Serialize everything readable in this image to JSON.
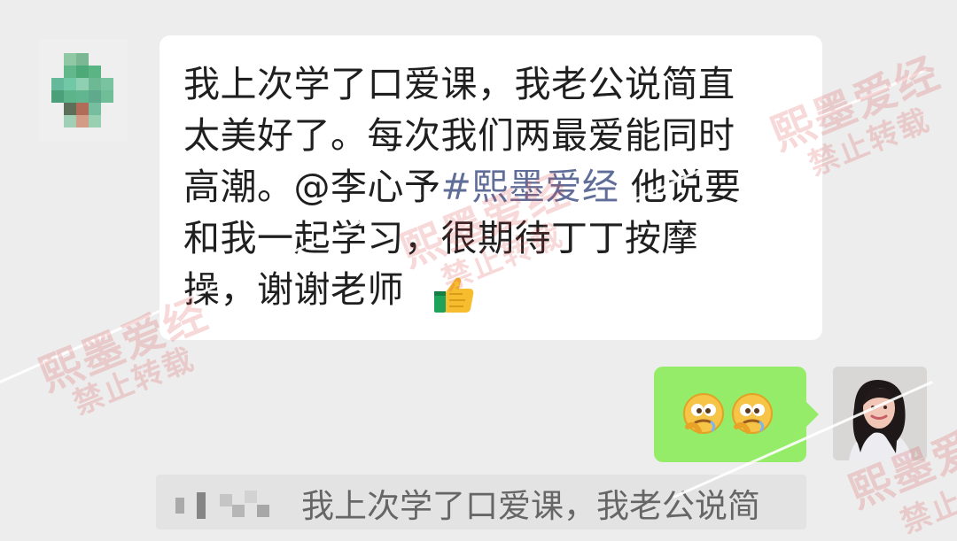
{
  "chat": {
    "incoming": {
      "line1": "我上次学了口爱课，我老公说简直",
      "line2": "太美好了。每次我们两最爱能同时",
      "line3_before": "高潮。@李心予",
      "line3_tag": "#熙墨爱经",
      "line3_after": "  他说要",
      "line4": "和我一起学习，很期待丁丁按摩",
      "line5": "操，谢谢老师",
      "thumb_icon": "thumbs-up-icon"
    },
    "outgoing": {
      "emoji_icon": "drooling-face-icon",
      "emoji_count": 2,
      "bubble_color": "#95ec69"
    },
    "quoted_preview": {
      "text": "我上次学了口爱课，我老公说简"
    }
  },
  "watermark": {
    "main": "熙墨爱经",
    "sub": "禁止转载"
  },
  "colors": {
    "chat_background": "#ededed",
    "incoming_bubble": "#ffffff",
    "mention_tag": "#5f6d98",
    "watermark": "#dc3f3f"
  }
}
